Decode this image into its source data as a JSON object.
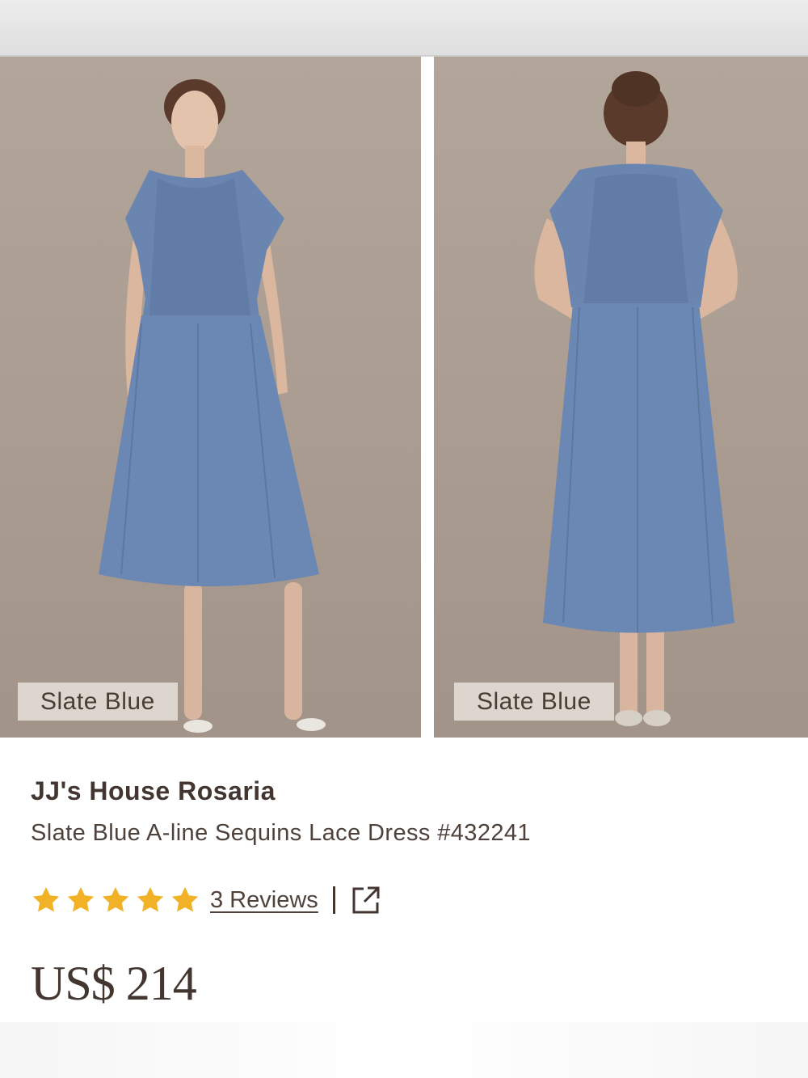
{
  "gallery": {
    "images": [
      {
        "view": "front",
        "color_label": "Slate Blue"
      },
      {
        "view": "back",
        "color_label": "Slate Blue"
      }
    ]
  },
  "product": {
    "brand": "JJ's House Rosaria",
    "name": "Slate Blue A-line Sequins Lace Dress #432241",
    "rating_stars": 5,
    "reviews_label": "3 Reviews",
    "separator": "|",
    "price": "US$ 214"
  },
  "icons": {
    "star": "star-icon",
    "share": "share-external-icon"
  },
  "colors": {
    "dress": "#6b87b3",
    "star": "#f2b227",
    "text": "#433630",
    "photo_background": "#aa9c90"
  }
}
